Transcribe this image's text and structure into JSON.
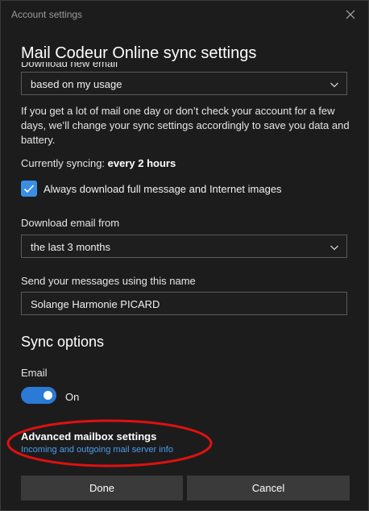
{
  "window": {
    "title": "Account settings"
  },
  "page": {
    "heading": "Mail Codeur Online sync settings",
    "cut_label": "Download new email"
  },
  "download_new_email": {
    "selected": "based on my usage"
  },
  "description": "If you get a lot of mail one day or don’t check your account for a few days, we’ll change your sync settings accordingly to save you data and battery.",
  "sync_status": {
    "prefix": "Currently syncing: ",
    "value": "every 2 hours"
  },
  "full_download": {
    "checked": true,
    "label": "Always download full message and Internet images"
  },
  "download_from": {
    "label": "Download email from",
    "selected": "the last 3 months"
  },
  "sender_name": {
    "label": "Send your messages using this name",
    "value": "Solange Harmonie PICARD"
  },
  "sync_options": {
    "title": "Sync options",
    "email_label": "Email",
    "email_state": "On"
  },
  "advanced": {
    "title": "Advanced mailbox settings",
    "link": "Incoming and outgoing mail server info"
  },
  "buttons": {
    "done": "Done",
    "cancel": "Cancel"
  },
  "colors": {
    "accent": "#3a8ee6",
    "link": "#4a9ef0",
    "annotation": "#e01010"
  },
  "icons": {
    "close": "close-icon",
    "chevron": "chevron-down-icon",
    "check": "checkmark-icon"
  }
}
